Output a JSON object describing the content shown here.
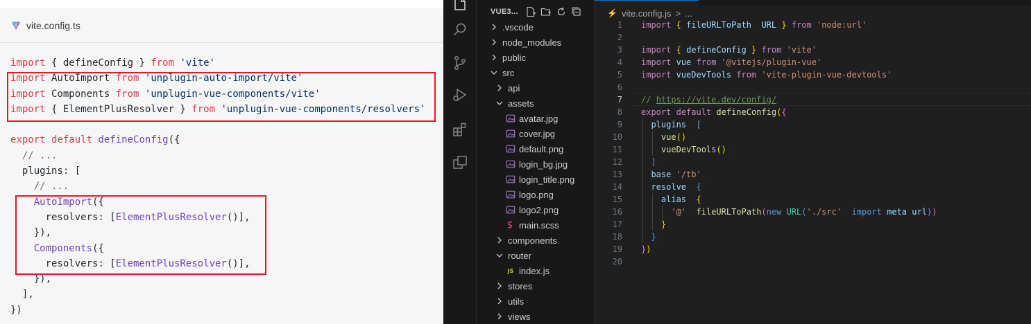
{
  "doc": {
    "filename": "vite.config.ts",
    "code_lines": [
      [
        [
          "k",
          "import"
        ],
        [
          "p",
          " { defineConfig } "
        ],
        [
          "k",
          "from"
        ],
        [
          "p",
          " "
        ],
        [
          "s",
          "'vite'"
        ]
      ],
      [
        [
          "k",
          "import"
        ],
        [
          "p",
          " AutoImport "
        ],
        [
          "k",
          "from"
        ],
        [
          "p",
          " "
        ],
        [
          "s",
          "'unplugin-auto-import/vite'"
        ]
      ],
      [
        [
          "k",
          "import"
        ],
        [
          "p",
          " Components "
        ],
        [
          "k",
          "from"
        ],
        [
          "p",
          " "
        ],
        [
          "s",
          "'unplugin-vue-components/vite'"
        ]
      ],
      [
        [
          "k",
          "import"
        ],
        [
          "p",
          " { ElementPlusResolver } "
        ],
        [
          "k",
          "from"
        ],
        [
          "p",
          " "
        ],
        [
          "s",
          "'unplugin-vue-components/resolvers'"
        ]
      ],
      [],
      [
        [
          "k",
          "export"
        ],
        [
          "p",
          " "
        ],
        [
          "k",
          "default"
        ],
        [
          "p",
          " "
        ],
        [
          "f",
          "defineConfig"
        ],
        [
          "p",
          "({"
        ]
      ],
      [
        [
          "c",
          "  // ..."
        ]
      ],
      [
        [
          "p",
          "  plugins: ["
        ]
      ],
      [
        [
          "c",
          "    // ..."
        ]
      ],
      [
        [
          "p",
          "    "
        ],
        [
          "f",
          "AutoImport"
        ],
        [
          "p",
          "({"
        ]
      ],
      [
        [
          "p",
          "      resolvers: ["
        ],
        [
          "f",
          "ElementPlusResolver"
        ],
        [
          "p",
          "()],"
        ]
      ],
      [
        [
          "p",
          "    }),"
        ]
      ],
      [
        [
          "p",
          "    "
        ],
        [
          "f",
          "Components"
        ],
        [
          "p",
          "({"
        ]
      ],
      [
        [
          "p",
          "      resolvers: ["
        ],
        [
          "f",
          "ElementPlusResolver"
        ],
        [
          "p",
          "()],"
        ]
      ],
      [
        [
          "p",
          "    }),"
        ]
      ],
      [
        [
          "p",
          "  ],"
        ]
      ],
      [
        [
          "p",
          "})"
        ]
      ]
    ]
  },
  "explorer": {
    "title": "VUE3...",
    "items": [
      {
        "label": ".vscode",
        "type": "folder",
        "depth": 0,
        "open": false
      },
      {
        "label": "node_modules",
        "type": "folder",
        "depth": 0,
        "open": false
      },
      {
        "label": "public",
        "type": "folder",
        "depth": 0,
        "open": false
      },
      {
        "label": "src",
        "type": "folder",
        "depth": 0,
        "open": true
      },
      {
        "label": "api",
        "type": "folder",
        "depth": 1,
        "open": false
      },
      {
        "label": "assets",
        "type": "folder",
        "depth": 1,
        "open": true
      },
      {
        "label": "avatar.jpg",
        "type": "image",
        "depth": 2
      },
      {
        "label": "cover.jpg",
        "type": "image",
        "depth": 2
      },
      {
        "label": "default.png",
        "type": "image",
        "depth": 2
      },
      {
        "label": "login_bg.jpg",
        "type": "image",
        "depth": 2
      },
      {
        "label": "login_title.png",
        "type": "image",
        "depth": 2
      },
      {
        "label": "logo.png",
        "type": "image",
        "depth": 2
      },
      {
        "label": "logo2.png",
        "type": "image",
        "depth": 2
      },
      {
        "label": "main.scss",
        "type": "scss",
        "depth": 2
      },
      {
        "label": "components",
        "type": "folder",
        "depth": 1,
        "open": false
      },
      {
        "label": "router",
        "type": "folder",
        "depth": 1,
        "open": true
      },
      {
        "label": "index.js",
        "type": "js",
        "depth": 2
      },
      {
        "label": "stores",
        "type": "folder",
        "depth": 1,
        "open": false
      },
      {
        "label": "utils",
        "type": "folder",
        "depth": 1,
        "open": false
      },
      {
        "label": "views",
        "type": "folder",
        "depth": 1,
        "open": false
      }
    ]
  },
  "editor": {
    "breadcrumb_file": "vite.config.js",
    "breadcrumb_sep": ">",
    "breadcrumb_more": "...",
    "current_line": 7,
    "lines": [
      [
        [
          "vk",
          "import"
        ],
        [
          "p",
          " "
        ],
        [
          "vy",
          "{"
        ],
        [
          "p",
          " "
        ],
        [
          "vv",
          "fileURLToPath"
        ],
        [
          "p",
          ", "
        ],
        [
          "vv",
          "URL"
        ],
        [
          "p",
          " "
        ],
        [
          "vy",
          "}"
        ],
        [
          "p",
          " "
        ],
        [
          "vk",
          "from"
        ],
        [
          "p",
          " "
        ],
        [
          "vs",
          "'node:url'"
        ]
      ],
      [],
      [
        [
          "vk",
          "import"
        ],
        [
          "p",
          " "
        ],
        [
          "vy",
          "{"
        ],
        [
          "p",
          " "
        ],
        [
          "vv",
          "defineConfig"
        ],
        [
          "p",
          " "
        ],
        [
          "vy",
          "}"
        ],
        [
          "p",
          " "
        ],
        [
          "vk",
          "from"
        ],
        [
          "p",
          " "
        ],
        [
          "vs",
          "'vite'"
        ]
      ],
      [
        [
          "vk",
          "import"
        ],
        [
          "p",
          " "
        ],
        [
          "vv",
          "vue"
        ],
        [
          "p",
          " "
        ],
        [
          "vk",
          "from"
        ],
        [
          "p",
          " "
        ],
        [
          "vs",
          "'@vitejs/plugin-vue'"
        ]
      ],
      [
        [
          "vk",
          "import"
        ],
        [
          "p",
          " "
        ],
        [
          "vv",
          "vueDevTools"
        ],
        [
          "p",
          " "
        ],
        [
          "vk",
          "from"
        ],
        [
          "p",
          " "
        ],
        [
          "vs",
          "'vite-plugin-vue-devtools'"
        ]
      ],
      [],
      [
        [
          "vcm",
          "// "
        ],
        [
          "vl",
          "https://vite.dev/config/"
        ]
      ],
      [
        [
          "vk",
          "export"
        ],
        [
          "p",
          " "
        ],
        [
          "vk",
          "default"
        ],
        [
          "p",
          " "
        ],
        [
          "vf",
          "defineConfig"
        ],
        [
          "vy",
          "("
        ],
        [
          "vp",
          "{"
        ]
      ],
      [
        [
          "p",
          "  "
        ],
        [
          "vv",
          "plugins"
        ],
        [
          "p",
          ": "
        ],
        [
          "vb",
          "["
        ]
      ],
      [
        [
          "p",
          "    "
        ],
        [
          "vf",
          "vue"
        ],
        [
          "vy",
          "()"
        ],
        [
          "p",
          ","
        ]
      ],
      [
        [
          "p",
          "    "
        ],
        [
          "vf",
          "vueDevTools"
        ],
        [
          "vy",
          "()"
        ],
        [
          "p",
          ","
        ]
      ],
      [
        [
          "p",
          "  "
        ],
        [
          "vb",
          "]"
        ],
        [
          "p",
          ","
        ]
      ],
      [
        [
          "p",
          "  "
        ],
        [
          "vv",
          "base"
        ],
        [
          "p",
          ":"
        ],
        [
          "vs",
          "'/tb'"
        ],
        [
          "p",
          ","
        ]
      ],
      [
        [
          "p",
          "  "
        ],
        [
          "vv",
          "resolve"
        ],
        [
          "p",
          ": "
        ],
        [
          "vb",
          "{"
        ]
      ],
      [
        [
          "p",
          "    "
        ],
        [
          "vv",
          "alias"
        ],
        [
          "p",
          ": "
        ],
        [
          "vy",
          "{"
        ]
      ],
      [
        [
          "p",
          "      "
        ],
        [
          "vs",
          "'@'"
        ],
        [
          "p",
          ": "
        ],
        [
          "vf",
          "fileURLToPath"
        ],
        [
          "vp",
          "("
        ],
        [
          "vb",
          "new"
        ],
        [
          "p",
          " "
        ],
        [
          "vc",
          "URL"
        ],
        [
          "vb",
          "("
        ],
        [
          "vs",
          "'./src'"
        ],
        [
          "p",
          ", "
        ],
        [
          "vb",
          "import"
        ],
        [
          "p",
          "."
        ],
        [
          "vv",
          "meta"
        ],
        [
          "p",
          "."
        ],
        [
          "vv",
          "url"
        ],
        [
          "vb",
          ")"
        ],
        [
          "vp",
          ")"
        ]
      ],
      [
        [
          "p",
          "    "
        ],
        [
          "vy",
          "}"
        ],
        [
          "p",
          ","
        ]
      ],
      [
        [
          "p",
          "  "
        ],
        [
          "vb",
          "}"
        ],
        [
          "p",
          ","
        ]
      ],
      [
        [
          "vp",
          "}"
        ],
        [
          "vy",
          ")"
        ]
      ],
      []
    ]
  },
  "colors": {
    "highlight_box": "#d81e2c",
    "vscode_bg": "#1f1f1f",
    "accent": "#0078d4"
  },
  "icons": [
    "vite-icon",
    "files-icon",
    "search-icon",
    "source-control-icon",
    "run-debug-icon",
    "extensions-icon",
    "remote-explorer-icon",
    "new-file-icon",
    "new-folder-icon",
    "refresh-icon",
    "collapse-all-icon",
    "chevron-right-icon",
    "chevron-down-icon",
    "image-file-icon",
    "scss-file-icon",
    "js-file-icon"
  ]
}
